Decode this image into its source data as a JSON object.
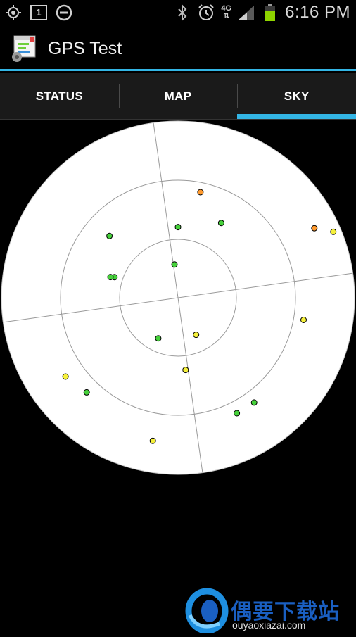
{
  "status_bar": {
    "time": "6:16 PM",
    "network_type": "4G",
    "left_icons": [
      "gps-icon",
      "notification-count-icon",
      "do-not-disturb-icon"
    ],
    "notification_count": "1",
    "right_icons": [
      "bluetooth-icon",
      "alarm-icon",
      "signal-icon",
      "battery-icon"
    ],
    "battery_color": "#8fd400"
  },
  "app": {
    "title": "GPS Test",
    "accent_color": "#33b5e5"
  },
  "tabs": [
    {
      "label": "STATUS",
      "active": false
    },
    {
      "label": "MAP",
      "active": false
    },
    {
      "label": "SKY",
      "active": true
    }
  ],
  "sky_plot": {
    "rings": 3,
    "rotation_deg": -8,
    "satellites": [
      {
        "az": 20,
        "el": 35,
        "color": "#ff9a2e"
      },
      {
        "az": 38,
        "el": 46,
        "color": "#46d13b"
      },
      {
        "az": 8,
        "el": 54,
        "color": "#46d13b"
      },
      {
        "az": 2,
        "el": 73,
        "color": "#46d13b"
      },
      {
        "az": 320,
        "el": 43,
        "color": "#46d13b"
      },
      {
        "az": 296,
        "el": 56,
        "color": "#46d13b"
      },
      {
        "az": 295,
        "el": 54,
        "color": "#46d13b"
      },
      {
        "az": 71,
        "el": 12,
        "color": "#ff9a2e"
      },
      {
        "az": 75,
        "el": 4,
        "color": "#f5f03a"
      },
      {
        "az": 108,
        "el": 25,
        "color": "#f5f03a"
      },
      {
        "az": 162,
        "el": 69,
        "color": "#f5f03a"
      },
      {
        "az": 214,
        "el": 67,
        "color": "#46d13b"
      },
      {
        "az": 182,
        "el": 53,
        "color": "#f5f03a"
      },
      {
        "az": 243,
        "el": 20,
        "color": "#f5f03a"
      },
      {
        "az": 232,
        "el": 23,
        "color": "#46d13b"
      },
      {
        "az": 198,
        "el": 16,
        "color": "#f5f03a"
      },
      {
        "az": 161,
        "el": 24,
        "color": "#46d13b"
      },
      {
        "az": 152,
        "el": 24,
        "color": "#46d13b"
      }
    ]
  },
  "watermark": {
    "brand": "偶要下载站",
    "url": "ouyaoxiazai.com"
  }
}
